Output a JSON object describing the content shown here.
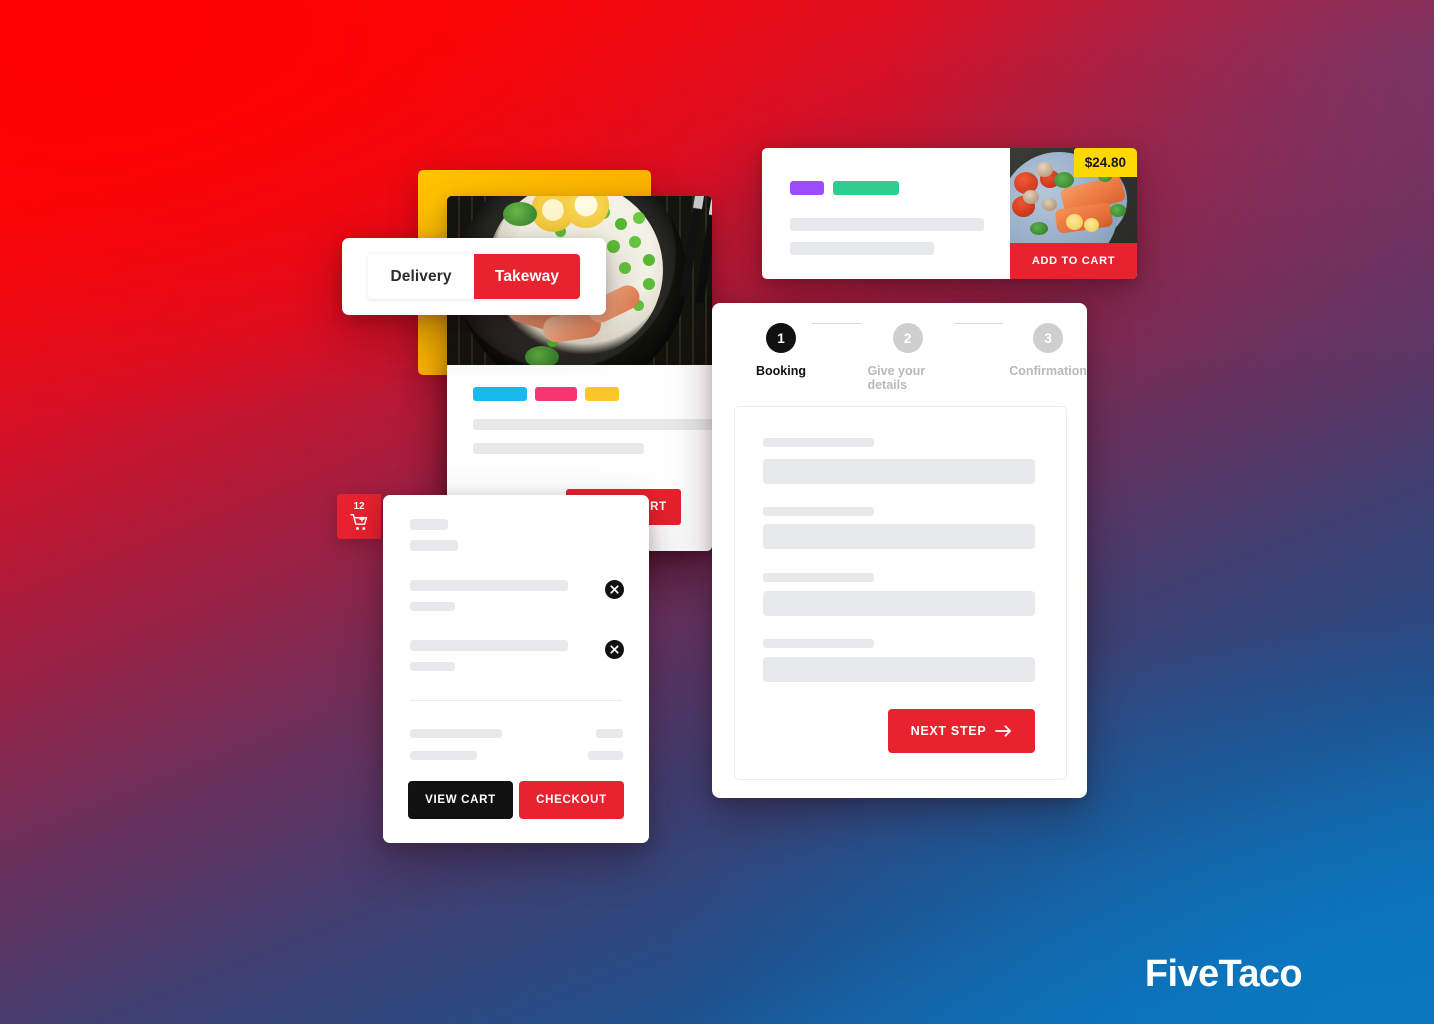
{
  "brand": {
    "name": "FiveTaco"
  },
  "background": {
    "colors": {
      "top_left": "#fa0808",
      "bottom_left": "#0a72b8",
      "top_right": "#4a4278",
      "bottom_right": "#0d6fb4"
    }
  },
  "order_type_toggle": {
    "options": [
      {
        "label": "Delivery",
        "selected": false
      },
      {
        "label": "Takeway",
        "selected": true
      }
    ],
    "active_color": "#e8222e"
  },
  "product_card": {
    "image_alt": "shrimp-rice-peas-bowl",
    "swatches": [
      {
        "name": "cyan",
        "color": "#18b9ef"
      },
      {
        "name": "pink",
        "color": "#f4356f"
      },
      {
        "name": "yellow",
        "color": "#fdc52c"
      }
    ],
    "add_to_cart_label": "ADD TO CART",
    "skeleton_lines": 2,
    "price_placeholder": true
  },
  "promo_card": {
    "tags": [
      {
        "name": "purple-tag",
        "color": "#9b4dff"
      },
      {
        "name": "green-tag",
        "color": "#2ecc8f"
      }
    ],
    "price": "$24.80",
    "price_bg": "#ffd800",
    "add_to_cart_label": "ADD TO CART",
    "image_alt": "salmon-tomato-mushroom-plate",
    "skeleton_lines": 2
  },
  "cart_badge": {
    "count": "12",
    "icon": "cart-plus-icon",
    "color": "#e8222e"
  },
  "mini_cart": {
    "items": [
      {
        "remove_icon": "close-icon"
      },
      {
        "remove_icon": "close-icon"
      }
    ],
    "totals_rows": 2,
    "view_cart_label": "VIEW CART",
    "checkout_label": "CHECKOUT"
  },
  "booking": {
    "steps": [
      {
        "number": "1",
        "label": "Booking",
        "state": "active"
      },
      {
        "number": "2",
        "label": "Give your details",
        "state": "idle"
      },
      {
        "number": "3",
        "label": "Confirmation",
        "state": "idle"
      }
    ],
    "form_fields": 4,
    "next_step_label": "NEXT STEP",
    "next_step_icon": "arrow-right-icon"
  }
}
